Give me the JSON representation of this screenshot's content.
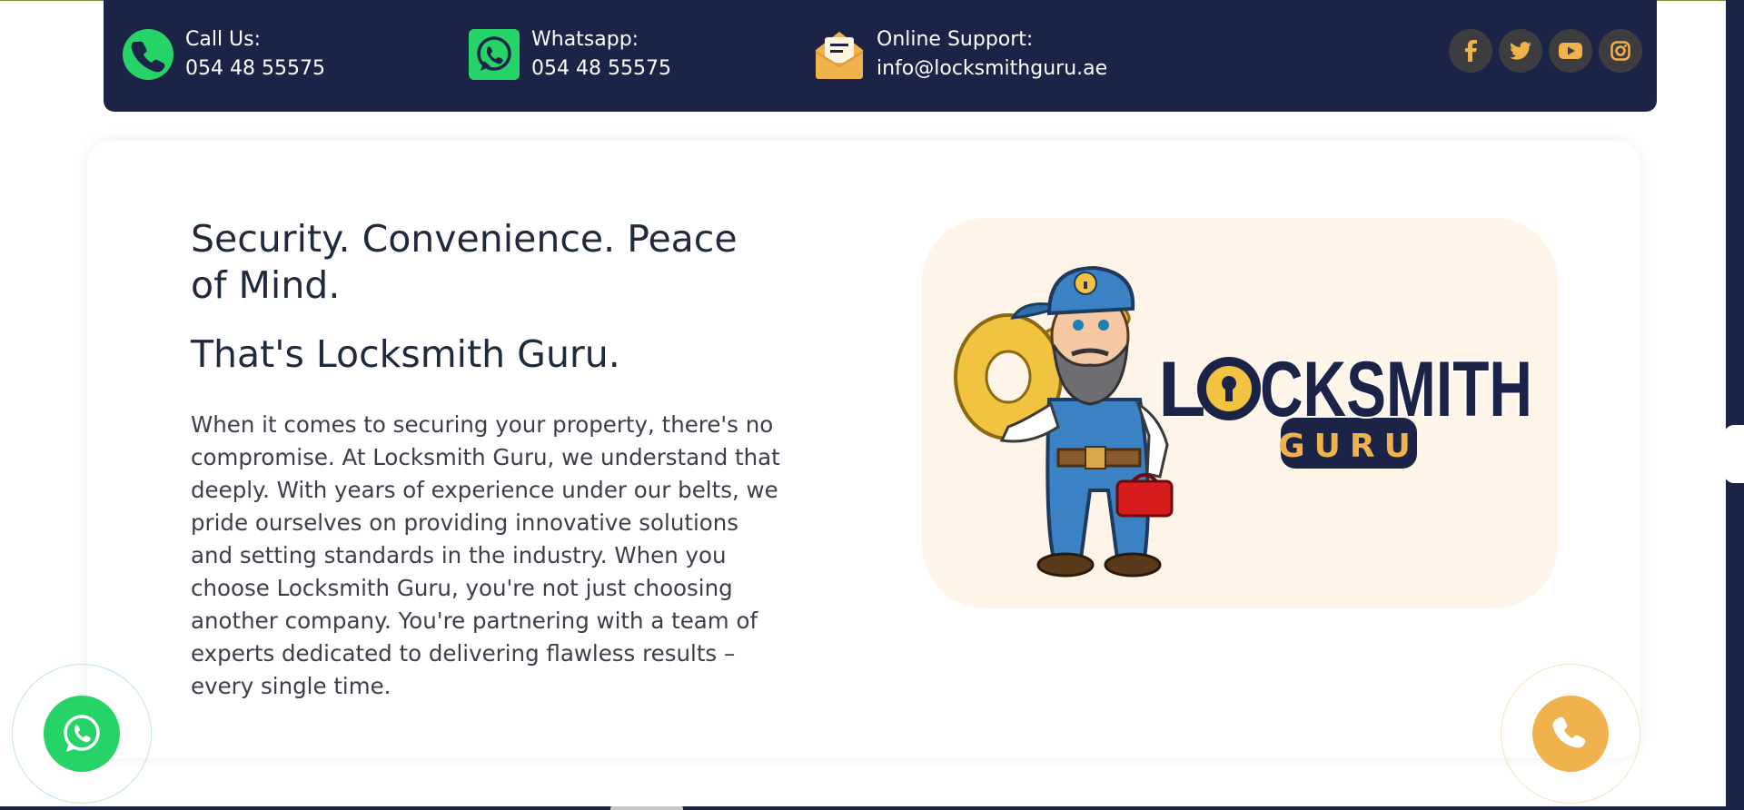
{
  "contact_bar": {
    "call": {
      "label": "Call Us:",
      "value": "054 48 55575",
      "icon": "phone-icon"
    },
    "whatsapp": {
      "label": "Whatsapp:",
      "value": "054 48 55575",
      "icon": "whatsapp-icon"
    },
    "support": {
      "label": "Online Support:",
      "value": "info@locksmithguru.ae",
      "icon": "mail-envelope-icon"
    },
    "social": [
      "facebook-icon",
      "twitter-icon",
      "youtube-icon",
      "instagram-icon"
    ]
  },
  "intro": {
    "heading": "Security. Convenience. Peace of Mind.",
    "subheading": "That's Locksmith Guru.",
    "paragraph": "When it comes to securing your property, there's no compromise. At Locksmith Guru, we understand that deeply. With years of experience under our belts, we pride ourselves on providing innovative solutions and setting standards in the industry. When you choose Locksmith Guru, you're not just choosing another company. You're partnering with a team of experts dedicated to delivering flawless results – every single time."
  },
  "logo": {
    "line1_before": "L",
    "line1_after": "CKSMITH",
    "line2": "GURU"
  },
  "floating": {
    "left": "whatsapp-icon",
    "right": "phone-icon"
  },
  "colors": {
    "navy": "#1b2347",
    "green": "#25d366",
    "gold": "#f0b24c",
    "logo_panel": "#fff4e8"
  }
}
